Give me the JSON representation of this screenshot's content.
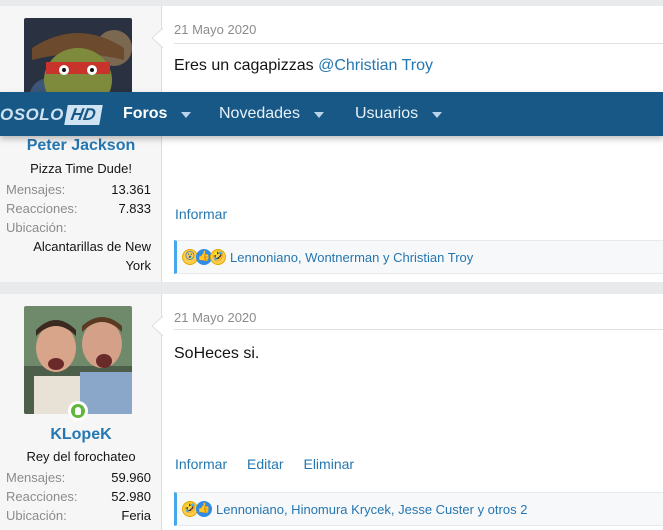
{
  "navbar": {
    "logo_text": "OSOLO",
    "logo_hd": "HD",
    "tabs": [
      {
        "label": "Foros",
        "active": true
      },
      {
        "label": "Novedades",
        "active": false
      },
      {
        "label": "Usuarios",
        "active": false
      }
    ]
  },
  "posts": [
    {
      "user": {
        "name": "Peter Jackson",
        "title": "Pizza Time Dude!",
        "stats": [
          {
            "label": "Mensajes:",
            "value": "13.361"
          },
          {
            "label": "Reacciones:",
            "value": "7.833"
          },
          {
            "label": "Ubicación:",
            "value": ""
          }
        ],
        "location": "Alcantarillas de New York",
        "online": false
      },
      "date": "21 Mayo 2020",
      "message": "Eres un cagapizzas ",
      "mention": "@Christian Troy",
      "actions": [
        "Informar"
      ],
      "reactions": {
        "icons": [
          "wow-icon",
          "like-icon",
          "laugh-icon"
        ],
        "text": "Lennoniano, Wontnerman y Christian Troy"
      }
    },
    {
      "user": {
        "name": "KLopeK",
        "title": "Rey del forochateo",
        "stats": [
          {
            "label": "Mensajes:",
            "value": "59.960"
          },
          {
            "label": "Reacciones:",
            "value": "52.980"
          },
          {
            "label": "Ubicación:",
            "value": "Feria"
          }
        ],
        "online": true
      },
      "date": "21 Mayo 2020",
      "message": "SoHeces si.",
      "actions": [
        "Informar",
        "Editar",
        "Eliminar"
      ],
      "reactions": {
        "icons": [
          "laugh-icon",
          "like-icon"
        ],
        "text": "Lennoniano, Hinomura Krycek, Jesse Custer y otros 2"
      }
    }
  ],
  "colors": {
    "navbar": "#185886",
    "link": "#2577b1",
    "reaction_bar_accent": "#47a7eb",
    "online": "#63b53b"
  }
}
